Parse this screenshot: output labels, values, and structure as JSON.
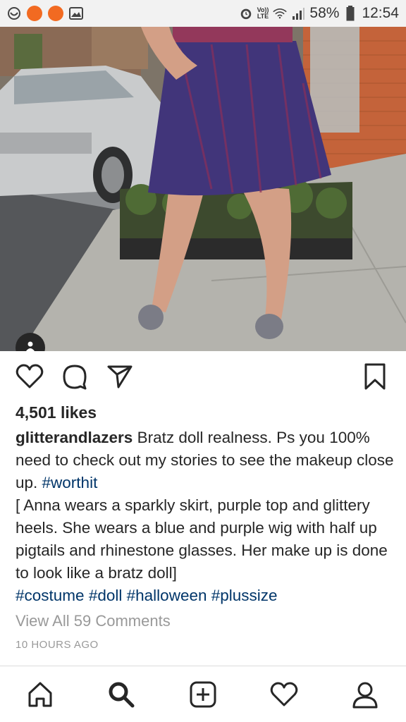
{
  "status_bar": {
    "battery": "58%",
    "time": "12:54",
    "network_label": "LTE",
    "network_top": "Vo))"
  },
  "post": {
    "likes": "4,501 likes",
    "username": "glitterandlazers",
    "caption_text": " Bratz doll realness. Ps you 100% need to check out my stories to see the makeup close up. ",
    "caption_hashtag": "#worthit",
    "caption_description": "[ Anna wears a sparkly skirt, purple top and glittery heels. She wears a blue and purple wig with half up pigtails and rhinestone glasses. Her make up is done to look like a bratz doll]",
    "hashtags": [
      "#costume",
      "#doll",
      "#halloween",
      "#plussize"
    ],
    "view_comments": "View All 59 Comments",
    "timestamp": "10 HOURS AGO"
  },
  "icons": {
    "like": "heart-icon",
    "comment": "comment-icon",
    "share": "paper-plane-icon",
    "save": "bookmark-icon",
    "tag": "user-tag-icon"
  },
  "bottom_nav": [
    "home-icon",
    "search-icon",
    "add-post-icon",
    "activity-heart-icon",
    "profile-icon"
  ],
  "colors": {
    "orange_notification": "#f26a21",
    "hashtag": "#003569",
    "muted_text": "#999999"
  }
}
